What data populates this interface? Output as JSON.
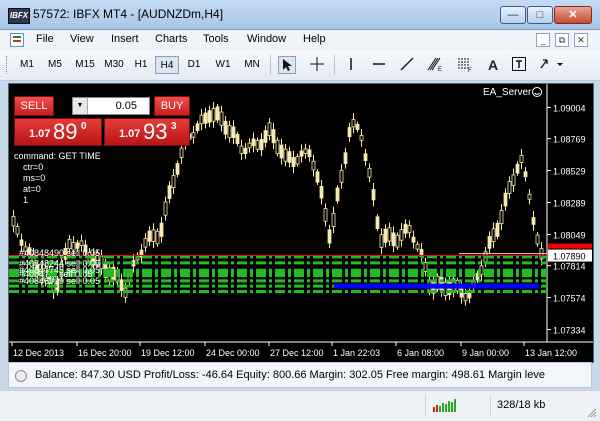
{
  "window": {
    "title": "57572: IBFX MT4 - [AUDNZDm,H4]",
    "app_icon_label": "IBFX"
  },
  "menu": {
    "items": [
      "File",
      "View",
      "Insert",
      "Charts",
      "Tools",
      "Window",
      "Help"
    ]
  },
  "toolbar": {
    "timeframes": [
      "M1",
      "M5",
      "M15",
      "M30",
      "H1",
      "H4",
      "D1",
      "W1",
      "MN"
    ],
    "active_timeframe": "H4",
    "tools": [
      "cursor-icon",
      "crosshair-icon",
      "vertical-line-icon",
      "horizontal-line-icon",
      "trendline-icon",
      "fibonacci-icon",
      "fibonacci-fan-icon",
      "text-icon",
      "text-label-icon",
      "arrows-icon"
    ]
  },
  "trade_panel": {
    "sell_label": "SELL",
    "buy_label": "BUY",
    "volume": "0.05",
    "sell_price": {
      "prefix": "1.07",
      "big": "89",
      "sup": "0"
    },
    "buy_price": {
      "prefix": "1.07",
      "big": "93",
      "sup": "3"
    }
  },
  "chart": {
    "server_label": "EA_Server",
    "comments": [
      "command: GET TIME",
      "ctr=0",
      "ms=0",
      "at=0",
      "1"
    ],
    "price_labels": [
      "1.09004",
      "1.08769",
      "1.08529",
      "1.08289",
      "1.08049",
      "1.07814",
      "1.07574",
      "1.07334"
    ],
    "current_price": "1.07890",
    "time_labels": [
      "12 Dec 2013",
      "16 Dec 20:00",
      "19 Dec 12:00",
      "24 Dec 00:00",
      "27 Dec 12:00",
      "1 Jan 22:03",
      "6 Jan 08:00",
      "9 Jan 00:00",
      "13 Jan 12:00"
    ],
    "orders": [
      "#40848490 sell 0.05",
      "#40848244 sell 0.05",
      "#40847745 sell 0.05",
      "#40847... sell 0.05",
      "#40846979 sell 0.05"
    ],
    "colors": {
      "candle": "#f5e9b0",
      "order_line": "#22bb22",
      "price_line": "#ff0000",
      "highlight": "#0000ff"
    }
  },
  "status": {
    "text": "Balance: 847.30 USD  Profit/Loss: -46.64  Equity: 800.66  Margin: 302.05  Free margin: 498.61  Margin leve"
  },
  "bottom": {
    "traffic": "328/18 kb"
  }
}
